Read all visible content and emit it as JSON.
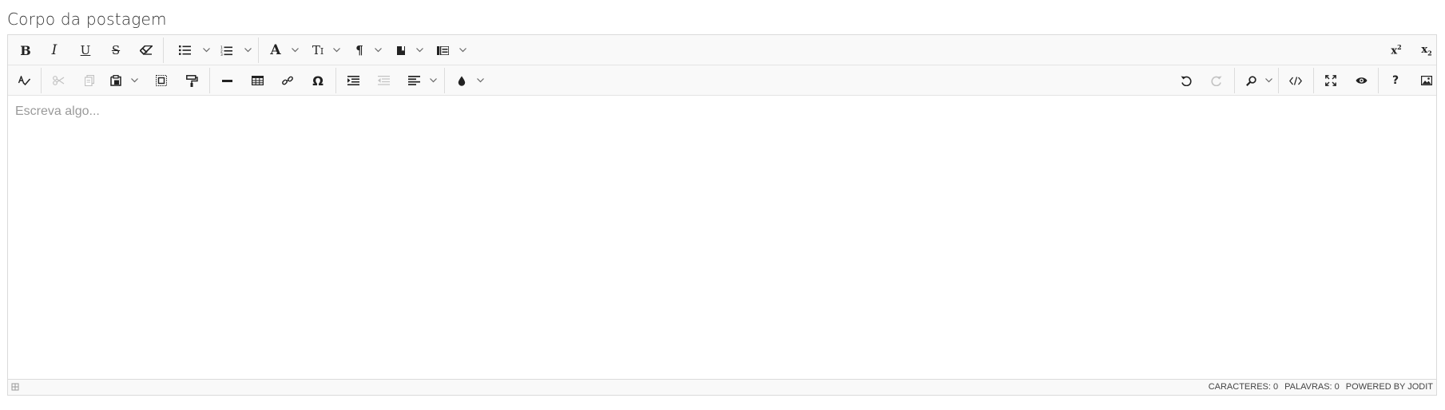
{
  "field": {
    "label": "Corpo da postagem"
  },
  "toolbar": {
    "row1": [
      {
        "name": "bold-icon"
      },
      {
        "name": "italic-icon"
      },
      {
        "name": "underline-icon"
      },
      {
        "name": "strikethrough-icon"
      },
      {
        "name": "eraser-icon"
      },
      {
        "name": "unordered-list-icon"
      },
      {
        "name": "ordered-list-icon"
      },
      {
        "name": "font-icon"
      },
      {
        "name": "font-size-icon"
      },
      {
        "name": "paragraph-icon"
      },
      {
        "name": "classes-icon"
      },
      {
        "name": "line-height-icon"
      },
      {
        "name": "superscript-icon"
      },
      {
        "name": "subscript-icon"
      }
    ],
    "row2": [
      {
        "name": "spellcheck-icon"
      },
      {
        "name": "cut-icon"
      },
      {
        "name": "copy-icon"
      },
      {
        "name": "paste-icon"
      },
      {
        "name": "select-all-icon"
      },
      {
        "name": "copy-format-icon"
      },
      {
        "name": "horizontal-rule-icon"
      },
      {
        "name": "table-icon"
      },
      {
        "name": "link-icon"
      },
      {
        "name": "special-char-icon"
      },
      {
        "name": "indent-icon"
      },
      {
        "name": "outdent-icon"
      },
      {
        "name": "align-icon"
      },
      {
        "name": "brush-icon"
      },
      {
        "name": "undo-icon"
      },
      {
        "name": "redo-icon"
      },
      {
        "name": "find-icon"
      },
      {
        "name": "source-icon"
      },
      {
        "name": "fullsize-icon"
      },
      {
        "name": "preview-icon"
      },
      {
        "name": "help-icon"
      },
      {
        "name": "image-icon"
      }
    ],
    "special_char_glyph": "Ω",
    "help_glyph": "?"
  },
  "editor": {
    "placeholder": "Escreva algo..."
  },
  "statusbar": {
    "chars": "CARACTERES: 0",
    "words": "PALAVRAS: 0",
    "powered": "POWERED BY JODIT"
  },
  "colors": {
    "border": "#dadada",
    "toolbar_bg": "#f9f9f9",
    "icon": "#222222",
    "icon_disabled": "#c2c2c2",
    "placeholder": "#9a9a9a"
  }
}
